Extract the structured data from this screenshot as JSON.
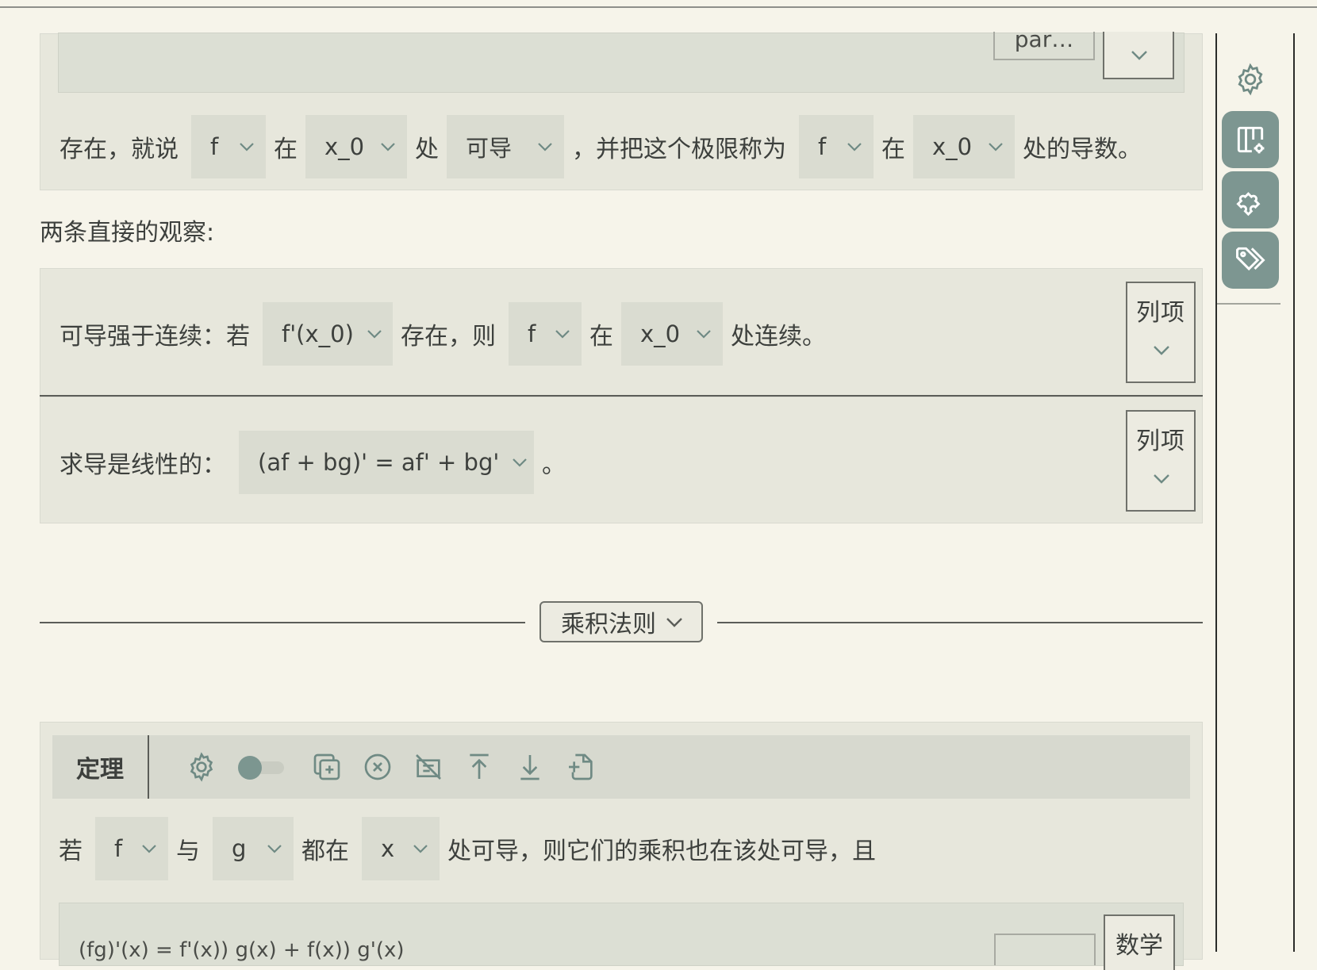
{
  "colors": {
    "accent": "#7d9691",
    "icon": "#6f8a84",
    "card": "#e7e7dc",
    "select": "#dadcd1"
  },
  "top_card": {
    "truncated_box_label": "par…",
    "sentence": {
      "t1": "存在，就说",
      "s1": "f",
      "t2": "在",
      "s2": "x_0",
      "t3": "处",
      "s3": "可导",
      "t4": "，并把这个极限称为",
      "s4": "f",
      "t5": "在",
      "s5": "x_0",
      "t6": "处的导数。"
    }
  },
  "observations_heading": "两条直接的观察:",
  "items": [
    {
      "t1": "可导强于连续：若",
      "s1": "f'(x_0)",
      "t2": "存在，则",
      "s2": "f",
      "t3": "在",
      "s3": "x_0",
      "t4": "处连续。",
      "button": "列项"
    },
    {
      "t1": "求导是线性的：",
      "s1": "(af + bg)' = af' + bg'",
      "t2": "。",
      "button": "列项"
    }
  ],
  "section": {
    "label": "乘积法则"
  },
  "theorem": {
    "title": "定理",
    "toolbar_icons": [
      "gear-icon",
      "toggle",
      "copy-add-icon",
      "close-circle-icon",
      "hide-icon",
      "move-top-icon",
      "move-bottom-icon",
      "add-file-icon"
    ],
    "sentence": {
      "t1": "若",
      "s1": "f",
      "t2": "与",
      "s2": "g",
      "t3": "都在",
      "s3": "x",
      "t4": "处可导，则它们的乘积也在该处可导，且"
    },
    "formula_partial": "(fg)'(x) = f'(x)) g(x) + f(x)) g'(x)",
    "math_button": "数学"
  },
  "sidebar": {
    "icons": [
      "settings-gear-icon",
      "layout-settings-icon",
      "puzzle-icon",
      "tags-icon"
    ]
  }
}
